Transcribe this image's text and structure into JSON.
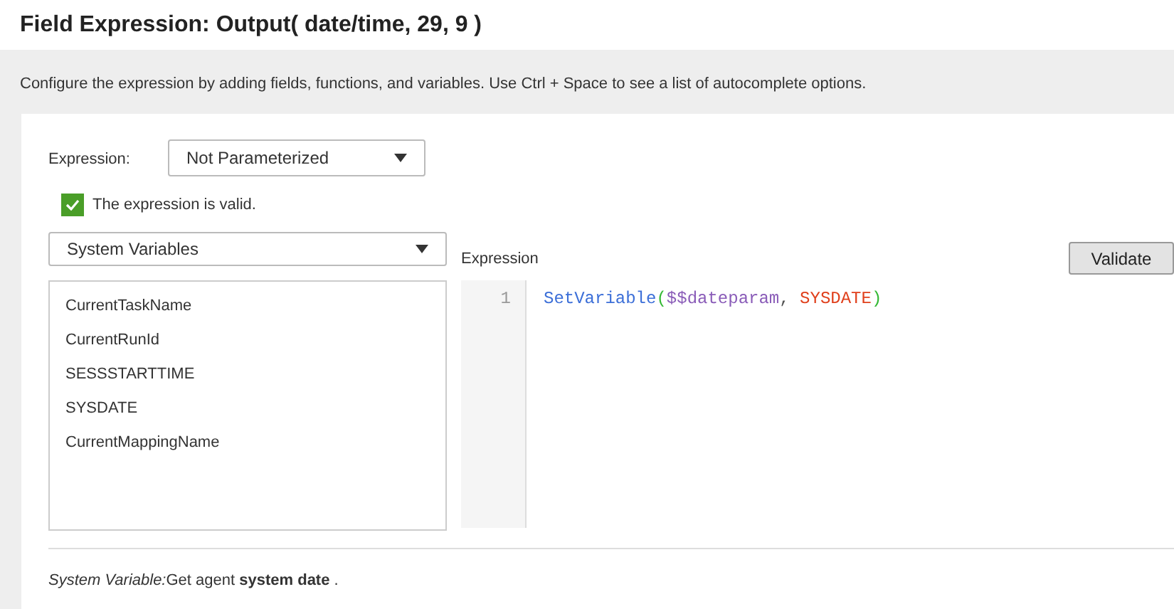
{
  "title": "Field Expression: Output( date/time, 29, 9 )",
  "description": "Configure the expression by adding fields, functions, and variables. Use Ctrl + Space to see a list of autocomplete options.",
  "expression_label": "Expression:",
  "expression_select": {
    "value": "Not Parameterized"
  },
  "validity": {
    "checked": true,
    "label": "The expression is valid."
  },
  "category_select": {
    "value": "System Variables"
  },
  "variables": [
    {
      "label": "CurrentTaskName",
      "selected": false
    },
    {
      "label": "CurrentRunId",
      "selected": false
    },
    {
      "label": "SESSSTARTTIME",
      "selected": false
    },
    {
      "label": "SYSDATE",
      "selected": false
    },
    {
      "label": "CurrentMappingName",
      "selected": false
    }
  ],
  "editor": {
    "label": "Expression",
    "line_numbers": [
      "1"
    ],
    "tokens": [
      {
        "kind": "function",
        "text": "SetVariable"
      },
      {
        "kind": "paren",
        "text": "("
      },
      {
        "kind": "variable",
        "text": "$$dateparam"
      },
      {
        "kind": "punct",
        "text": ", "
      },
      {
        "kind": "constant",
        "text": "SYSDATE"
      },
      {
        "kind": "paren",
        "text": ")"
      }
    ]
  },
  "validate_button": "Validate",
  "info": {
    "label": "System Variable:",
    "text": "Get agent **system date** ."
  }
}
